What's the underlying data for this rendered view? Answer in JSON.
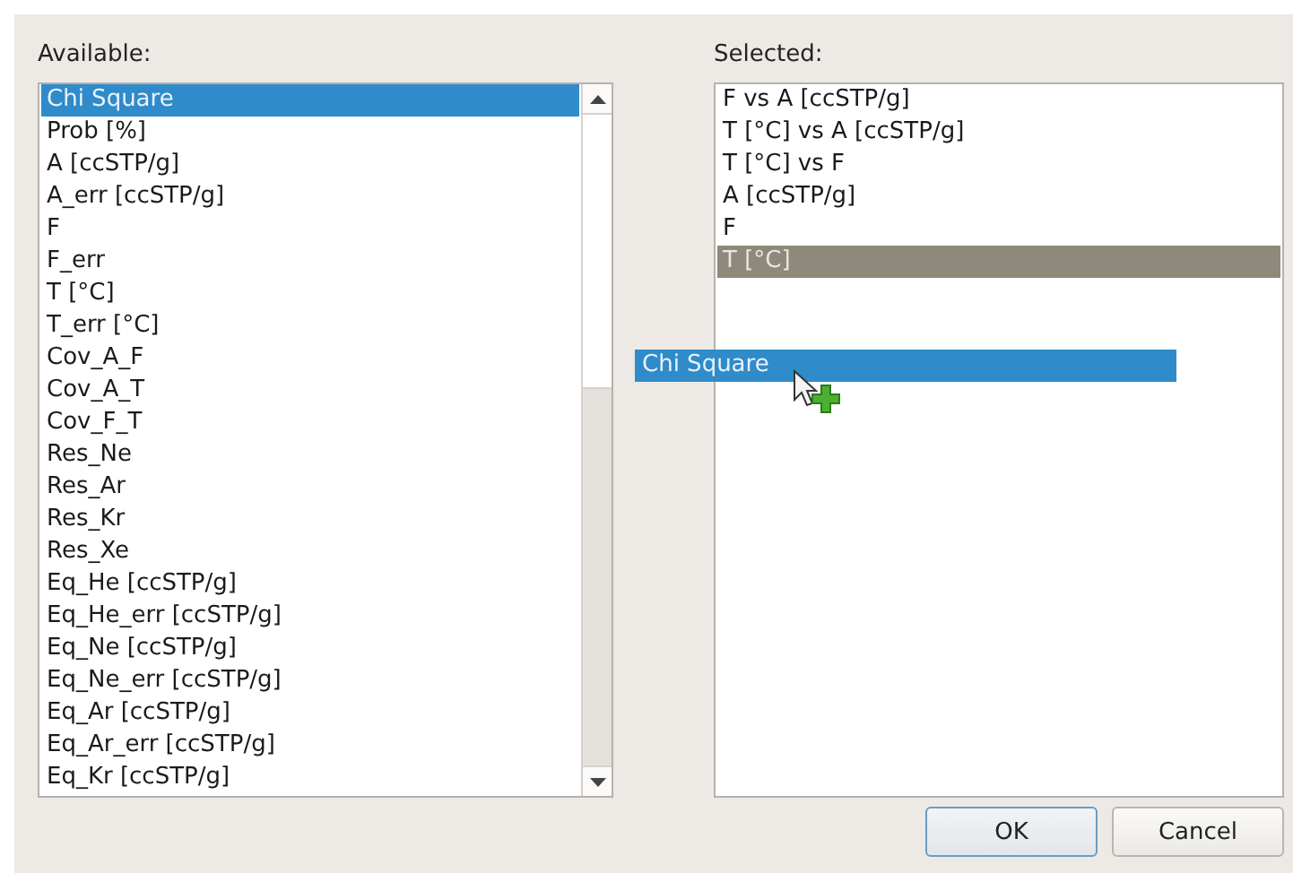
{
  "available": {
    "label": "Available:",
    "items": [
      {
        "label": "Chi Square",
        "selected": true
      },
      {
        "label": "Prob [%]",
        "selected": false
      },
      {
        "label": "A [ccSTP/g]",
        "selected": false
      },
      {
        "label": "A_err [ccSTP/g]",
        "selected": false
      },
      {
        "label": "F",
        "selected": false
      },
      {
        "label": "F_err",
        "selected": false
      },
      {
        "label": "T [°C]",
        "selected": false
      },
      {
        "label": "T_err [°C]",
        "selected": false
      },
      {
        "label": "Cov_A_F",
        "selected": false
      },
      {
        "label": "Cov_A_T",
        "selected": false
      },
      {
        "label": "Cov_F_T",
        "selected": false
      },
      {
        "label": "Res_Ne",
        "selected": false
      },
      {
        "label": "Res_Ar",
        "selected": false
      },
      {
        "label": "Res_Kr",
        "selected": false
      },
      {
        "label": "Res_Xe",
        "selected": false
      },
      {
        "label": "Eq_He [ccSTP/g]",
        "selected": false
      },
      {
        "label": "Eq_He_err [ccSTP/g]",
        "selected": false
      },
      {
        "label": "Eq_Ne [ccSTP/g]",
        "selected": false
      },
      {
        "label": "Eq_Ne_err [ccSTP/g]",
        "selected": false
      },
      {
        "label": "Eq_Ar [ccSTP/g]",
        "selected": false
      },
      {
        "label": "Eq_Ar_err [ccSTP/g]",
        "selected": false
      },
      {
        "label": "Eq_Kr [ccSTP/g]",
        "selected": false
      }
    ]
  },
  "selected_list": {
    "label": "Selected:",
    "items": [
      {
        "label": "F vs A [ccSTP/g]",
        "selected": false
      },
      {
        "label": "T [°C] vs A [ccSTP/g]",
        "selected": false
      },
      {
        "label": "T [°C] vs F",
        "selected": false
      },
      {
        "label": "A [ccSTP/g]",
        "selected": false
      },
      {
        "label": "F",
        "selected": false
      },
      {
        "label": "T [°C]",
        "selected": true
      }
    ]
  },
  "drag_item": {
    "label": "Chi Square"
  },
  "buttons": [
    {
      "label": "OK",
      "default": true
    },
    {
      "label": "Cancel",
      "default": false
    }
  ]
}
